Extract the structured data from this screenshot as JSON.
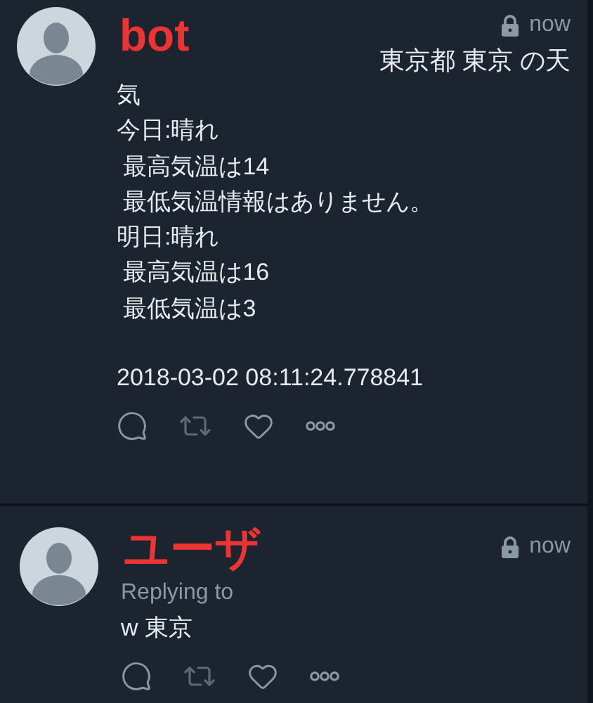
{
  "tweets": [
    {
      "name": "bot",
      "time": "now",
      "locked": true,
      "lead": "東京都 東京 の天",
      "paragraphs": [
        [
          "気",
          "今日:晴れ",
          " 最高気温は14",
          " 最低気温情報はありません。",
          "明日:晴れ",
          " 最高気温は16",
          " 最低気温は3"
        ],
        [
          "2018-03-02 08:11:24.778841"
        ]
      ]
    },
    {
      "name": "ユーザ",
      "time": "now",
      "locked": true,
      "replying": "Replying to",
      "paragraphs": [
        [
          "w 東京"
        ]
      ]
    }
  ]
}
